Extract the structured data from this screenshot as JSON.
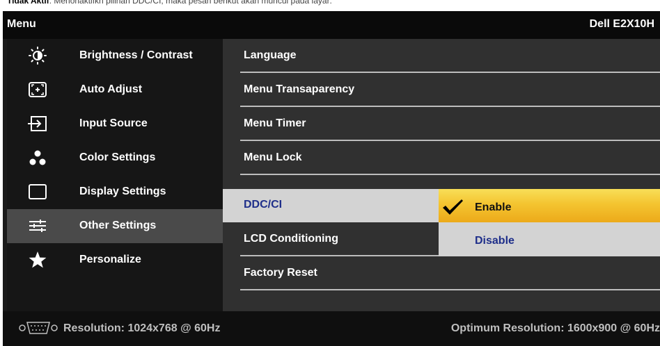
{
  "caption": {
    "bold_text": "Tidak Aktif",
    "rest_text": ": Menonaktifkn pilihan DDC/CI, maka pesan berikut akan muncul pada layar:"
  },
  "header": {
    "title": "Menu",
    "model": "Dell E2X10H"
  },
  "menu": {
    "items": [
      {
        "label": "Brightness / Contrast",
        "icon": "brightness-icon"
      },
      {
        "label": "Auto Adjust",
        "icon": "auto-adjust-icon"
      },
      {
        "label": "Input Source",
        "icon": "input-source-icon"
      },
      {
        "label": "Color Settings",
        "icon": "color-settings-icon"
      },
      {
        "label": "Display Settings",
        "icon": "display-settings-icon"
      },
      {
        "label": "Other Settings",
        "icon": "sliders-icon"
      },
      {
        "label": "Personalize",
        "icon": "star-icon"
      }
    ],
    "active_index": 5
  },
  "submenu": {
    "items": [
      {
        "label": "Language"
      },
      {
        "label": "Menu Transaparency"
      },
      {
        "label": "Menu Timer"
      },
      {
        "label": "Menu Lock"
      },
      {
        "label": "DDC/CI"
      },
      {
        "label": "LCD Conditioning"
      },
      {
        "label": "Factory Reset"
      }
    ],
    "selected_index": 4
  },
  "options": {
    "enable": "Enable",
    "disable": "Disable",
    "checked": "enable"
  },
  "footer": {
    "current_resolution": "Resolution: 1024x768 @ 60Hz",
    "optimum_resolution": "Optimum Resolution: 1600x900 @ 60Hz"
  },
  "colors": {
    "osd_background": "#1a1a1a",
    "active_menu": "#4a4a4a",
    "submenu_background": "#303030",
    "selected_submenu": "#d3d3d3",
    "highlight_yellow": "#f4c430",
    "selected_text_blue": "#1f2f8a"
  }
}
